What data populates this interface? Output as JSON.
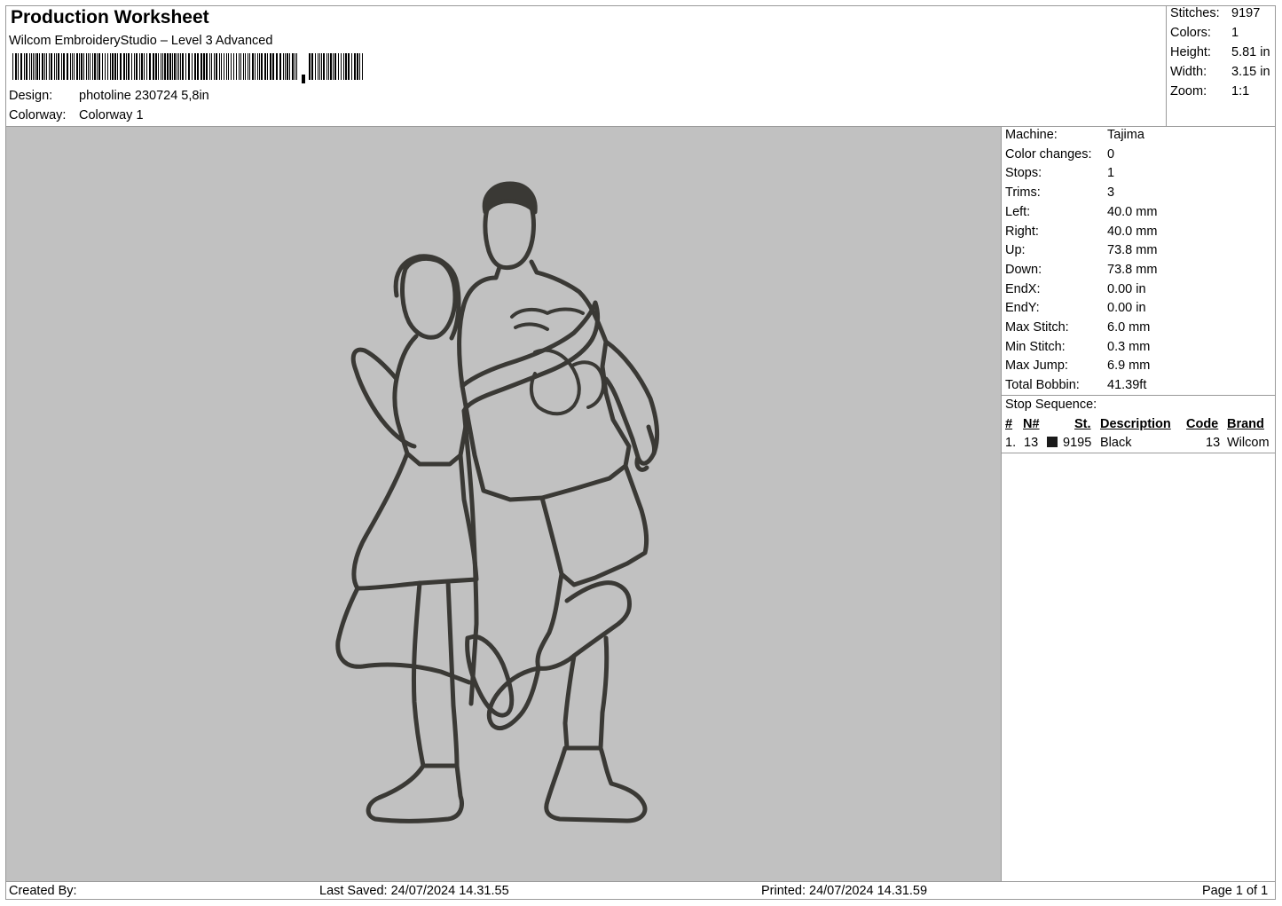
{
  "header": {
    "title": "Production Worksheet",
    "software": "Wilcom EmbroideryStudio – Level 3 Advanced",
    "design_label": "Design:",
    "design_value": "photoline 230724 5,8in",
    "colorway_label": "Colorway:",
    "colorway_value": "Colorway 1"
  },
  "summary": {
    "stitches_label": "Stitches:",
    "stitches_value": "9197",
    "colors_label": "Colors:",
    "colors_value": "1",
    "height_label": "Height:",
    "height_value": "5.81 in",
    "width_label": "Width:",
    "width_value": "3.15 in",
    "zoom_label": "Zoom:",
    "zoom_value": "1:1"
  },
  "machine_info": [
    {
      "label": "Machine:",
      "value": "Tajima"
    },
    {
      "label": "Color changes:",
      "value": "0"
    },
    {
      "label": "Stops:",
      "value": "1"
    },
    {
      "label": "Trims:",
      "value": "3"
    },
    {
      "label": "Left:",
      "value": "40.0 mm"
    },
    {
      "label": "Right:",
      "value": "40.0 mm"
    },
    {
      "label": "Up:",
      "value": "73.8 mm"
    },
    {
      "label": "Down:",
      "value": "73.8 mm"
    },
    {
      "label": "EndX:",
      "value": "0.00 in"
    },
    {
      "label": "EndY:",
      "value": "0.00 in"
    },
    {
      "label": "Max Stitch:",
      "value": "6.0 mm"
    },
    {
      "label": "Min Stitch:",
      "value": "0.3 mm"
    },
    {
      "label": "Max Jump:",
      "value": "6.9 mm"
    },
    {
      "label": "Total Bobbin:",
      "value": "41.39ft"
    }
  ],
  "stop_sequence": {
    "title": "Stop Sequence:",
    "headers": {
      "num": "#",
      "n": "N#",
      "st": "St.",
      "description": "Description",
      "code": "Code",
      "brand": "Brand"
    },
    "rows": [
      {
        "num": "1.",
        "n": "13",
        "swatch_color": "#1a1a1a",
        "st": "9195",
        "description": "Black",
        "code": "13",
        "brand": "Wilcom"
      }
    ]
  },
  "footer": {
    "created_by": "Created By:",
    "last_saved": "Last Saved: 24/07/2024 14.31.55",
    "printed": "Printed: 24/07/2024 14.31.59",
    "page": "Page 1 of 1"
  },
  "colors": {
    "canvas_bg": "#c1c1c1",
    "thread": "#3a3935"
  }
}
